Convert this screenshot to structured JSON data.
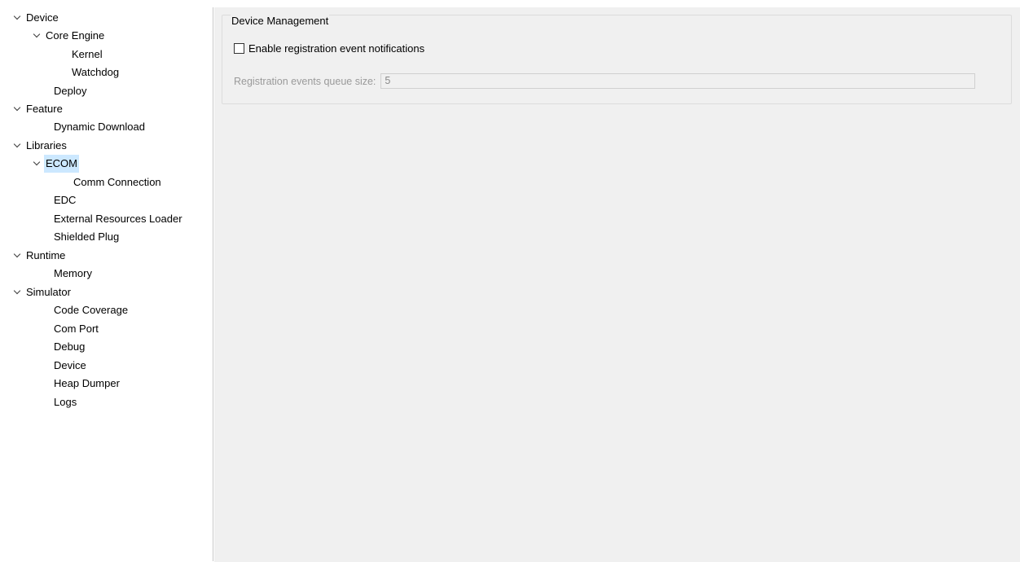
{
  "tree": {
    "items": [
      {
        "label": "Device",
        "expanded": true
      },
      {
        "label": "Core Engine",
        "expanded": true
      },
      {
        "label": "Kernel"
      },
      {
        "label": "Watchdog"
      },
      {
        "label": "Deploy"
      },
      {
        "label": "Feature",
        "expanded": true
      },
      {
        "label": "Dynamic Download"
      },
      {
        "label": "Libraries",
        "expanded": true
      },
      {
        "label": "ECOM",
        "expanded": true,
        "selected": true
      },
      {
        "label": "Comm Connection"
      },
      {
        "label": "EDC"
      },
      {
        "label": "External Resources Loader"
      },
      {
        "label": "Shielded Plug"
      },
      {
        "label": "Runtime",
        "expanded": true
      },
      {
        "label": "Memory"
      },
      {
        "label": "Simulator",
        "expanded": true
      },
      {
        "label": "Code Coverage"
      },
      {
        "label": "Com Port"
      },
      {
        "label": "Debug"
      },
      {
        "label": "Device"
      },
      {
        "label": "Heap Dumper"
      },
      {
        "label": "Logs"
      }
    ],
    "selection_color": "#cce8ff"
  },
  "main": {
    "group_title": "Device Management",
    "checkbox_label": "Enable registration event notifications",
    "checkbox_checked": false,
    "queue_label": "Registration events queue size:",
    "queue_value": "5",
    "queue_enabled": false
  },
  "icons": {
    "expand": "chevron-down-icon"
  }
}
